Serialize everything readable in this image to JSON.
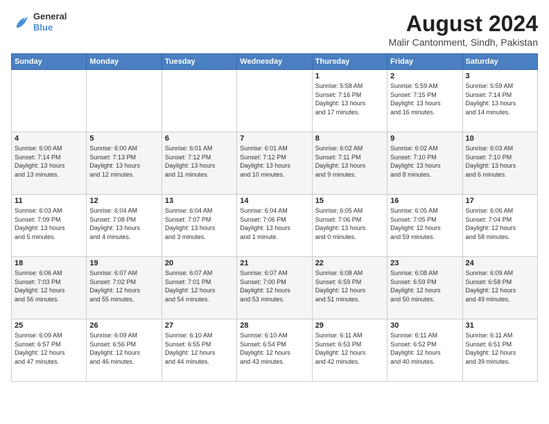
{
  "logo": {
    "line1": "General",
    "line2": "Blue"
  },
  "title": "August 2024",
  "subtitle": "Malir Cantonment, Sindh, Pakistan",
  "days": [
    "Sunday",
    "Monday",
    "Tuesday",
    "Wednesday",
    "Thursday",
    "Friday",
    "Saturday"
  ],
  "weeks": [
    [
      {
        "date": "",
        "content": ""
      },
      {
        "date": "",
        "content": ""
      },
      {
        "date": "",
        "content": ""
      },
      {
        "date": "",
        "content": ""
      },
      {
        "date": "1",
        "content": "Sunrise: 5:58 AM\nSunset: 7:16 PM\nDaylight: 13 hours\nand 17 minutes."
      },
      {
        "date": "2",
        "content": "Sunrise: 5:59 AM\nSunset: 7:15 PM\nDaylight: 13 hours\nand 16 minutes."
      },
      {
        "date": "3",
        "content": "Sunrise: 5:59 AM\nSunset: 7:14 PM\nDaylight: 13 hours\nand 14 minutes."
      }
    ],
    [
      {
        "date": "4",
        "content": "Sunrise: 6:00 AM\nSunset: 7:14 PM\nDaylight: 13 hours\nand 13 minutes."
      },
      {
        "date": "5",
        "content": "Sunrise: 6:00 AM\nSunset: 7:13 PM\nDaylight: 13 hours\nand 12 minutes."
      },
      {
        "date": "6",
        "content": "Sunrise: 6:01 AM\nSunset: 7:12 PM\nDaylight: 13 hours\nand 11 minutes."
      },
      {
        "date": "7",
        "content": "Sunrise: 6:01 AM\nSunset: 7:12 PM\nDaylight: 13 hours\nand 10 minutes."
      },
      {
        "date": "8",
        "content": "Sunrise: 6:02 AM\nSunset: 7:11 PM\nDaylight: 13 hours\nand 9 minutes."
      },
      {
        "date": "9",
        "content": "Sunrise: 6:02 AM\nSunset: 7:10 PM\nDaylight: 13 hours\nand 8 minutes."
      },
      {
        "date": "10",
        "content": "Sunrise: 6:03 AM\nSunset: 7:10 PM\nDaylight: 13 hours\nand 6 minutes."
      }
    ],
    [
      {
        "date": "11",
        "content": "Sunrise: 6:03 AM\nSunset: 7:09 PM\nDaylight: 13 hours\nand 5 minutes."
      },
      {
        "date": "12",
        "content": "Sunrise: 6:04 AM\nSunset: 7:08 PM\nDaylight: 13 hours\nand 4 minutes."
      },
      {
        "date": "13",
        "content": "Sunrise: 6:04 AM\nSunset: 7:07 PM\nDaylight: 13 hours\nand 3 minutes."
      },
      {
        "date": "14",
        "content": "Sunrise: 6:04 AM\nSunset: 7:06 PM\nDaylight: 13 hours\nand 1 minute."
      },
      {
        "date": "15",
        "content": "Sunrise: 6:05 AM\nSunset: 7:06 PM\nDaylight: 13 hours\nand 0 minutes."
      },
      {
        "date": "16",
        "content": "Sunrise: 6:05 AM\nSunset: 7:05 PM\nDaylight: 12 hours\nand 59 minutes."
      },
      {
        "date": "17",
        "content": "Sunrise: 6:06 AM\nSunset: 7:04 PM\nDaylight: 12 hours\nand 58 minutes."
      }
    ],
    [
      {
        "date": "18",
        "content": "Sunrise: 6:06 AM\nSunset: 7:03 PM\nDaylight: 12 hours\nand 56 minutes."
      },
      {
        "date": "19",
        "content": "Sunrise: 6:07 AM\nSunset: 7:02 PM\nDaylight: 12 hours\nand 55 minutes."
      },
      {
        "date": "20",
        "content": "Sunrise: 6:07 AM\nSunset: 7:01 PM\nDaylight: 12 hours\nand 54 minutes."
      },
      {
        "date": "21",
        "content": "Sunrise: 6:07 AM\nSunset: 7:00 PM\nDaylight: 12 hours\nand 53 minutes."
      },
      {
        "date": "22",
        "content": "Sunrise: 6:08 AM\nSunset: 6:59 PM\nDaylight: 12 hours\nand 51 minutes."
      },
      {
        "date": "23",
        "content": "Sunrise: 6:08 AM\nSunset: 6:59 PM\nDaylight: 12 hours\nand 50 minutes."
      },
      {
        "date": "24",
        "content": "Sunrise: 6:09 AM\nSunset: 6:58 PM\nDaylight: 12 hours\nand 49 minutes."
      }
    ],
    [
      {
        "date": "25",
        "content": "Sunrise: 6:09 AM\nSunset: 6:57 PM\nDaylight: 12 hours\nand 47 minutes."
      },
      {
        "date": "26",
        "content": "Sunrise: 6:09 AM\nSunset: 6:56 PM\nDaylight: 12 hours\nand 46 minutes."
      },
      {
        "date": "27",
        "content": "Sunrise: 6:10 AM\nSunset: 6:55 PM\nDaylight: 12 hours\nand 44 minutes."
      },
      {
        "date": "28",
        "content": "Sunrise: 6:10 AM\nSunset: 6:54 PM\nDaylight: 12 hours\nand 43 minutes."
      },
      {
        "date": "29",
        "content": "Sunrise: 6:11 AM\nSunset: 6:53 PM\nDaylight: 12 hours\nand 42 minutes."
      },
      {
        "date": "30",
        "content": "Sunrise: 6:11 AM\nSunset: 6:52 PM\nDaylight: 12 hours\nand 40 minutes."
      },
      {
        "date": "31",
        "content": "Sunrise: 6:11 AM\nSunset: 6:51 PM\nDaylight: 12 hours\nand 39 minutes."
      }
    ]
  ]
}
